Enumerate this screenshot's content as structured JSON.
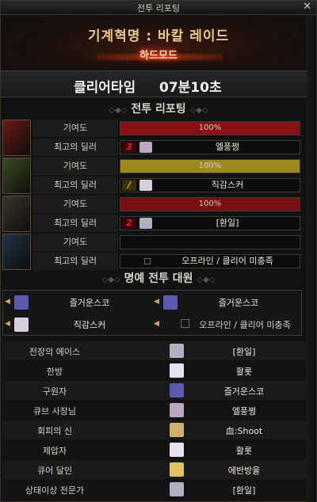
{
  "window": {
    "title": "전투 리포팅",
    "close_glyph": "✕"
  },
  "header": {
    "dungeon": "기계혁명 : 바칼 레이드",
    "mode": "하드모드"
  },
  "clear": {
    "label": "클리어타임",
    "time": "07분10초"
  },
  "battle_report": {
    "title": "전투 리포팅",
    "deco_left": "◇◆◇",
    "deco_right": "◇◆◇"
  },
  "members": [
    {
      "contribution_label": "기여도",
      "contribution_text": "100%",
      "contribution": 1.0,
      "bar_color": "#8a0f12",
      "dealer_label": "최고의 딜러",
      "badge": "3",
      "badge_color": "#e0222a",
      "dealer_name": "엘풍쩡",
      "portrait_color": "#6a1a14",
      "mini_color": "#b9a6c0"
    },
    {
      "contribution_label": "기여도",
      "contribution_text": "100%",
      "contribution": 1.0,
      "bar_color": "#9c8a1c",
      "dealer_label": "최고의 딜러",
      "badge": "/",
      "badge_color": "#e6c21a",
      "dealer_name": "직감스커",
      "portrait_color": "#3c4a22",
      "mini_color": "#d7d0dc"
    },
    {
      "contribution_label": "기여도",
      "contribution_text": "100%",
      "contribution": 1.0,
      "bar_color": "#7a0e10",
      "dealer_label": "최고의 딜러",
      "badge": "2",
      "badge_color": "#e0222a",
      "dealer_name": "[환일]",
      "portrait_color": "#3a3428",
      "mini_color": "#b3aec0"
    },
    {
      "contribution_label": "기여도",
      "contribution_text": "",
      "contribution": 0.0,
      "bar_color": "#7a0e10",
      "dealer_label": "최고의 딜러",
      "badge": "",
      "badge_color": "#888888",
      "dealer_name": "오프라인 / 클리어 미충족",
      "portrait_color": "#1e3344",
      "mini_color": ""
    }
  ],
  "honor": {
    "title": "명예 전투 대원",
    "deco_left": "◇◆◇",
    "deco_right": "◇◆◇",
    "entries": [
      {
        "name": "즐거운스코",
        "avatar_color": "#5a5ab0"
      },
      {
        "name": "즐거운스코",
        "avatar_color": "#5a5ab0"
      },
      {
        "name": "직감스커",
        "avatar_color": "#d7d0dc"
      },
      {
        "name": "오프라인 / 클리어 미충족",
        "avatar_color": ""
      }
    ]
  },
  "awards": [
    {
      "title": "전장의 에이스",
      "winner": "[환일]",
      "avatar_color": "#b3aec0"
    },
    {
      "title": "한방",
      "winner": "활롯",
      "avatar_color": "#e7e0f0"
    },
    {
      "title": "구원자",
      "winner": "즐거운스코",
      "avatar_color": "#5a5ab0"
    },
    {
      "title": "큐브 사장님",
      "winner": "엘풍쩡",
      "avatar_color": "#b9a6c0"
    },
    {
      "title": "회피의 신",
      "winner": "血:Shoot",
      "avatar_color": "#d0b070"
    },
    {
      "title": "제압자",
      "winner": "활롯",
      "avatar_color": "#e7e0f0"
    },
    {
      "title": "큐어 달인",
      "winner": "에반방울",
      "avatar_color": "#e0c060"
    },
    {
      "title": "상태이상 전문가",
      "winner": "[환일]",
      "avatar_color": "#b3aec0"
    }
  ]
}
